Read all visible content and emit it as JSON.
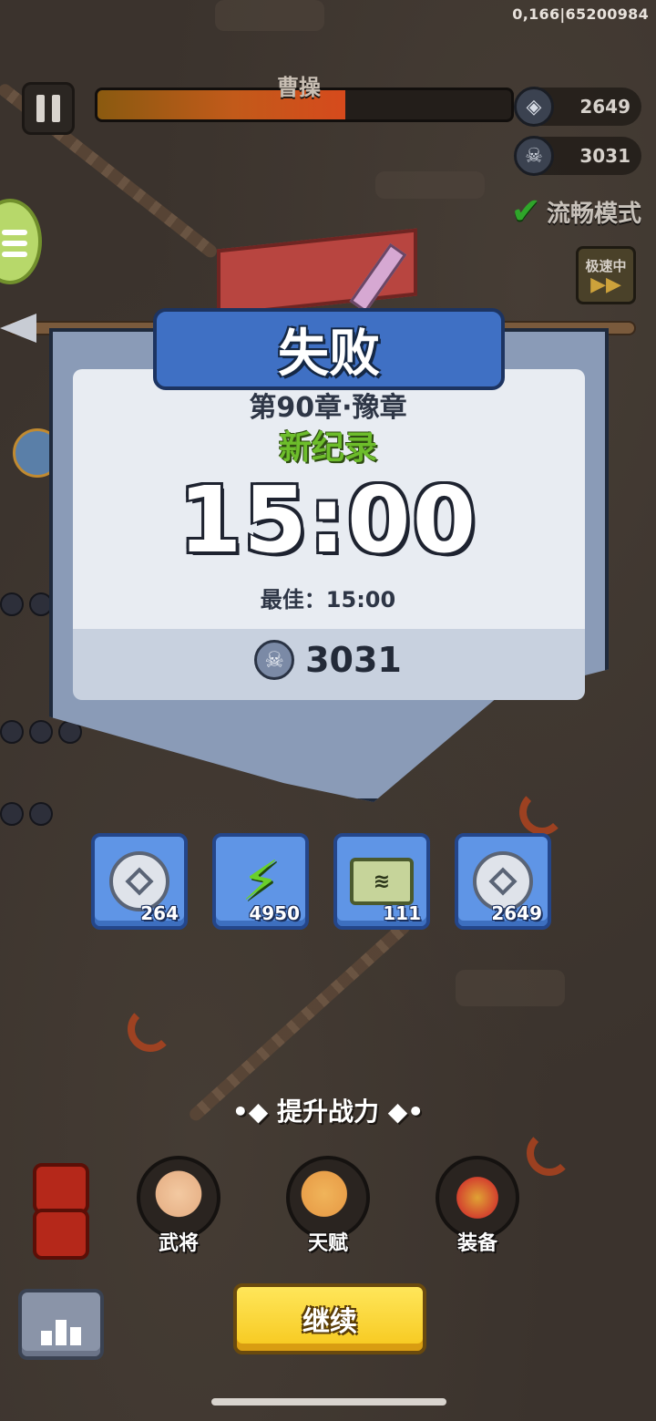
{
  "debug": {
    "coords": "0,166|65200984"
  },
  "hud": {
    "boss_name": "曹操",
    "boss_health_fraction": 0.6,
    "currency_1": {
      "icon": "coin-icon",
      "value": "2649"
    },
    "currency_2": {
      "icon": "skull-icon",
      "value": "3031"
    },
    "smooth_mode_label": "流畅模式",
    "speed_label": "极速中"
  },
  "result": {
    "title": "失败",
    "chapter": "第90章·豫章",
    "record_label": "新纪录",
    "time": "15:00",
    "best": "最佳：15:00",
    "kills": "3031"
  },
  "rewards": [
    {
      "icon": "silver-coin-icon",
      "count": "264"
    },
    {
      "icon": "energy-bolt-icon",
      "count": "4950"
    },
    {
      "icon": "scroll-icon",
      "count": "111"
    },
    {
      "icon": "silver-coin-icon",
      "count": "2649"
    }
  ],
  "power": {
    "title": "•◆ 提升战力 ◆•",
    "items": [
      {
        "icon": "hero-icon",
        "label": "武将"
      },
      {
        "icon": "talent-icon",
        "label": "天赋"
      },
      {
        "icon": "equipment-icon",
        "label": "装备"
      }
    ]
  },
  "actions": {
    "continue_label": "继续"
  },
  "colors": {
    "accent_blue": "#3f70c4",
    "record_green": "#6dbd2b",
    "button_yellow": "#f6c81d"
  }
}
